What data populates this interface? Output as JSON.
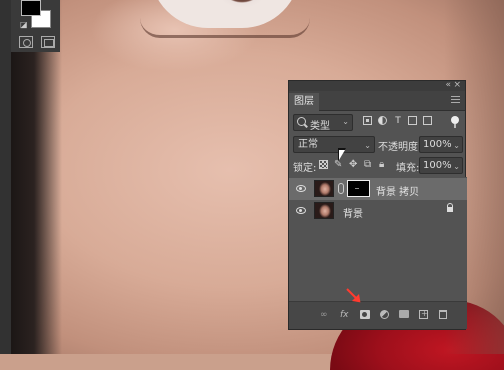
{
  "panel": {
    "tab_label": "图层",
    "filter": {
      "kind_label": "类型"
    },
    "blend_mode": "正常",
    "opacity_label": "不透明度:",
    "opacity_value": "100%",
    "lock_label": "锁定:",
    "fill_label": "填充:",
    "fill_value": "100%",
    "layers": [
      {
        "name": "背景 拷贝",
        "visible": true,
        "selected": true,
        "has_mask": true,
        "locked": false
      },
      {
        "name": "背景",
        "visible": true,
        "selected": false,
        "has_mask": false,
        "locked": true
      }
    ],
    "footer_icons": [
      "link-icon",
      "fx-icon",
      "add-mask-icon",
      "adjustment-icon",
      "group-icon",
      "new-layer-icon",
      "trash-icon"
    ]
  },
  "colors": {
    "panel_bg": "#535353",
    "selected_layer_bg": "#6b6b6b",
    "annotation_arrow": "#ff3b2f",
    "foreground_swatch": "#000000",
    "background_swatch": "#ffffff"
  }
}
